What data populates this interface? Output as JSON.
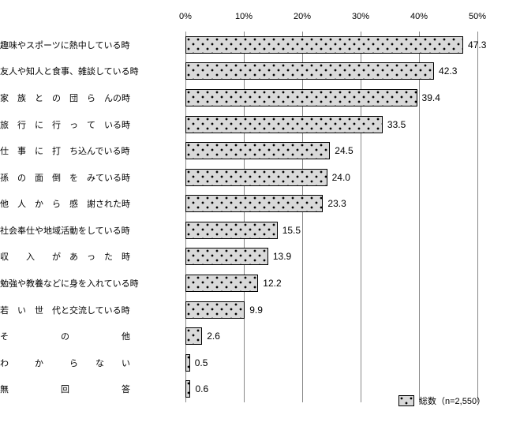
{
  "chart_data": {
    "type": "bar",
    "orientation": "horizontal",
    "categories": [
      "趣味やスポーツに熱中している時",
      "友人や知人と食事、雑談している時",
      "家族との団らんの時",
      "旅行に行っている時",
      "仕事に打ち込んでいる時",
      "孫の面倒をみている時",
      "他人から感謝された時",
      "社会奉仕や地域活動をしている時",
      "収入があった時",
      "勉強や教養などに身を入れている時",
      "若い世代と交流している時",
      "その他",
      "わからない",
      "無回答"
    ],
    "values": [
      47.3,
      42.3,
      39.4,
      33.5,
      24.5,
      24.0,
      23.3,
      15.5,
      13.9,
      12.2,
      9.9,
      2.6,
      0.5,
      0.6
    ],
    "xlabel": "",
    "ylabel": "",
    "xlim": [
      0,
      50
    ],
    "ticks": [
      0,
      10,
      20,
      30,
      40,
      50
    ],
    "tick_labels": [
      "0%",
      "10%",
      "20%",
      "30%",
      "40%",
      "50%"
    ],
    "legend": {
      "label": "総数（n=2,550）"
    }
  }
}
